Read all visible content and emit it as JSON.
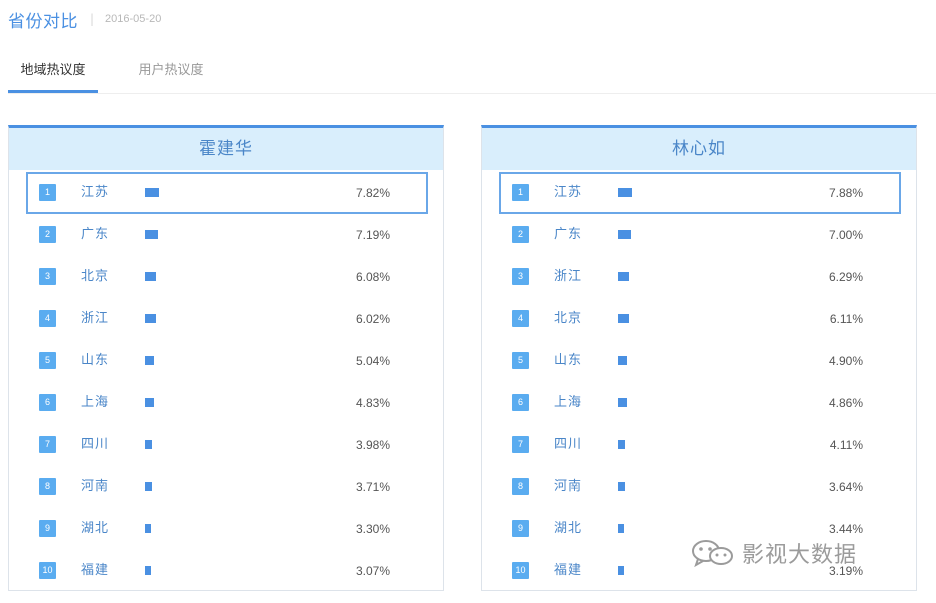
{
  "header": {
    "title": "省份对比",
    "separator": "|",
    "date": "2016-05-20"
  },
  "tabs": [
    {
      "label": "地域热议度",
      "active": true
    },
    {
      "label": "用户热议度",
      "active": false
    }
  ],
  "panels": [
    {
      "name": "霍建华",
      "rows": [
        {
          "rank": "1",
          "province": "江苏",
          "percent": "7.82%",
          "value": 7.82
        },
        {
          "rank": "2",
          "province": "广东",
          "percent": "7.19%",
          "value": 7.19
        },
        {
          "rank": "3",
          "province": "北京",
          "percent": "6.08%",
          "value": 6.08
        },
        {
          "rank": "4",
          "province": "浙江",
          "percent": "6.02%",
          "value": 6.02
        },
        {
          "rank": "5",
          "province": "山东",
          "percent": "5.04%",
          "value": 5.04
        },
        {
          "rank": "6",
          "province": "上海",
          "percent": "4.83%",
          "value": 4.83
        },
        {
          "rank": "7",
          "province": "四川",
          "percent": "3.98%",
          "value": 3.98
        },
        {
          "rank": "8",
          "province": "河南",
          "percent": "3.71%",
          "value": 3.71
        },
        {
          "rank": "9",
          "province": "湖北",
          "percent": "3.30%",
          "value": 3.3
        },
        {
          "rank": "10",
          "province": "福建",
          "percent": "3.07%",
          "value": 3.07
        }
      ]
    },
    {
      "name": "林心如",
      "rows": [
        {
          "rank": "1",
          "province": "江苏",
          "percent": "7.88%",
          "value": 7.88
        },
        {
          "rank": "2",
          "province": "广东",
          "percent": "7.00%",
          "value": 7.0
        },
        {
          "rank": "3",
          "province": "浙江",
          "percent": "6.29%",
          "value": 6.29
        },
        {
          "rank": "4",
          "province": "北京",
          "percent": "6.11%",
          "value": 6.11
        },
        {
          "rank": "5",
          "province": "山东",
          "percent": "4.90%",
          "value": 4.9
        },
        {
          "rank": "6",
          "province": "上海",
          "percent": "4.86%",
          "value": 4.86
        },
        {
          "rank": "7",
          "province": "四川",
          "percent": "4.11%",
          "value": 4.11
        },
        {
          "rank": "8",
          "province": "河南",
          "percent": "3.64%",
          "value": 3.64
        },
        {
          "rank": "9",
          "province": "湖北",
          "percent": "3.44%",
          "value": 3.44
        },
        {
          "rank": "10",
          "province": "福建",
          "percent": "3.19%",
          "value": 3.19
        }
      ]
    }
  ],
  "watermark": {
    "text": "影视大数据",
    "icon": "wechat-icon"
  },
  "colors": {
    "accent": "#4a90e2",
    "panel_header_bg": "#d9eefc",
    "rank_badge": "#5aacf0",
    "highlight_border": "#6aa7e8"
  }
}
